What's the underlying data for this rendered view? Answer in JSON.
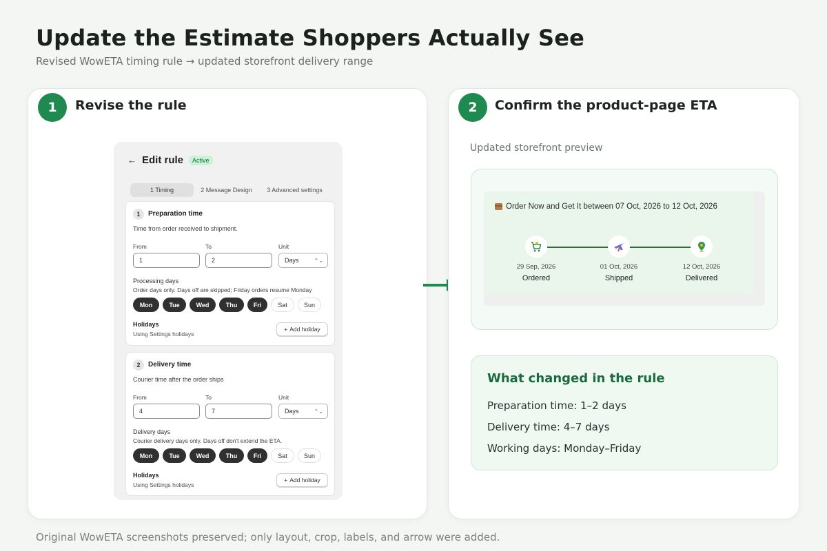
{
  "page": {
    "title": "Update the Estimate Shoppers Actually See",
    "subtitle": "Revised WowETA timing rule → updated storefront delivery range",
    "footer": "Original WowETA screenshots preserved; only layout, crop, labels, and arrow were added."
  },
  "colors": {
    "accent": "#1f8a4f",
    "dark_chip": "#303030",
    "preview_bg": "#eaf6ec"
  },
  "step1": {
    "number": "1",
    "title": "Revise the rule",
    "edit_rule": {
      "title": "Edit rule",
      "status": "Active",
      "tabs": [
        "1  Timing",
        "2  Message Design",
        "3  Advanced settings"
      ],
      "preparation": {
        "number": "1",
        "title": "Preparation time",
        "description": "Time from order received to shipment.",
        "from_label": "From",
        "to_label": "To",
        "unit_label": "Unit",
        "from_value": "1",
        "to_value": "2",
        "unit_value": "Days",
        "days_label": "Processing days",
        "days_help": "Order days only. Days off are skipped; Friday orders resume Monday",
        "days": [
          {
            "label": "Mon",
            "selected": true
          },
          {
            "label": "Tue",
            "selected": true
          },
          {
            "label": "Wed",
            "selected": true
          },
          {
            "label": "Thu",
            "selected": true
          },
          {
            "label": "Fri",
            "selected": true
          },
          {
            "label": "Sat",
            "selected": false
          },
          {
            "label": "Sun",
            "selected": false
          }
        ],
        "holidays_label": "Holidays",
        "holidays_help": "Using Settings holidays",
        "add_holiday": "Add holiday"
      },
      "delivery": {
        "number": "2",
        "title": "Delivery time",
        "description": "Courier time after the order ships",
        "from_label": "From",
        "to_label": "To",
        "unit_label": "Unit",
        "from_value": "4",
        "to_value": "7",
        "unit_value": "Days",
        "days_label": "Delivery days",
        "days_help": "Courier delivery days only. Days off don't extend the ETA.",
        "days": [
          {
            "label": "Mon",
            "selected": true
          },
          {
            "label": "Tue",
            "selected": true
          },
          {
            "label": "Wed",
            "selected": true
          },
          {
            "label": "Thu",
            "selected": true
          },
          {
            "label": "Fri",
            "selected": true
          },
          {
            "label": "Sat",
            "selected": false
          },
          {
            "label": "Sun",
            "selected": false
          }
        ],
        "holidays_label": "Holidays",
        "holidays_help": "Using Settings holidays",
        "add_holiday": "Add holiday"
      }
    }
  },
  "step2": {
    "number": "2",
    "title": "Confirm the product-page ETA",
    "preview_caption": "Updated storefront preview",
    "eta_message": "Order Now and Get It between 07 Oct, 2026 to 12 Oct, 2026",
    "timeline": [
      {
        "date": "29 Sep, 2026",
        "label": "Ordered",
        "icon": "cart-icon"
      },
      {
        "date": "01 Oct, 2026",
        "label": "Shipped",
        "icon": "plane-icon"
      },
      {
        "date": "12 Oct, 2026",
        "label": "Delivered",
        "icon": "location-pin-icon"
      }
    ],
    "changes_title": "What changed in the rule",
    "changes": [
      "Preparation time: 1–2 days",
      "Delivery time: 4–7 days",
      "Working days: Monday–Friday"
    ]
  }
}
